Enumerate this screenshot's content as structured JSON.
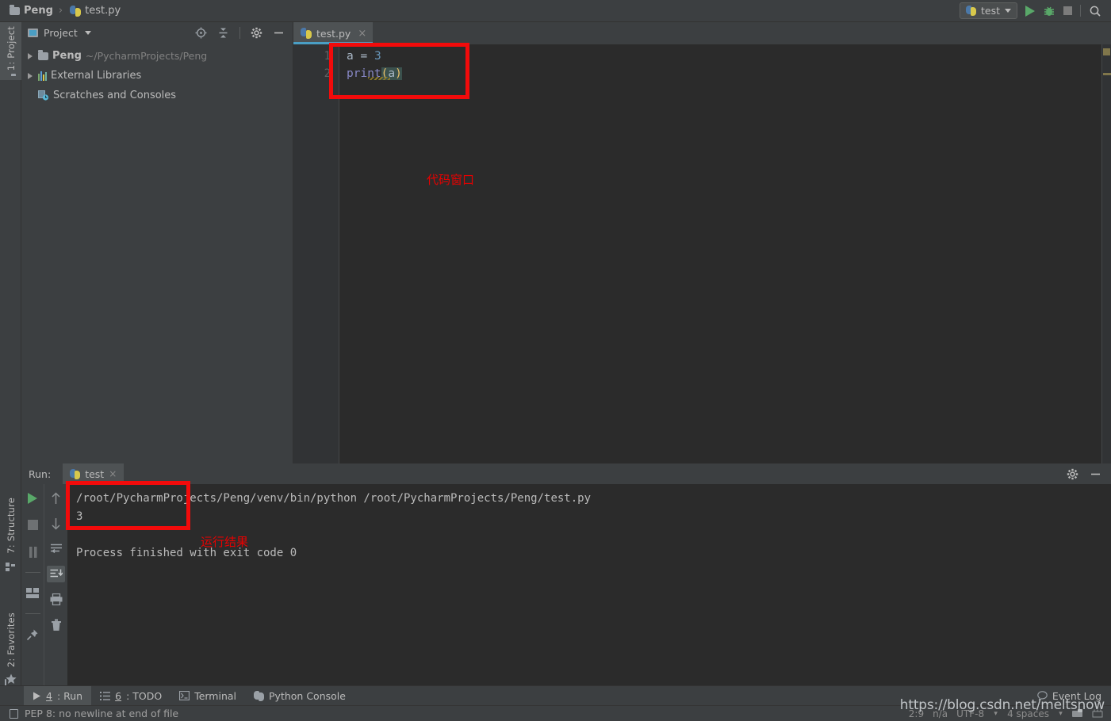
{
  "app": {
    "theme_bg": "#3c3f41",
    "editor_bg": "#2b2b2b",
    "accent": "#4a9ec4",
    "annotation_color": "#f20b0b"
  },
  "topbar": {
    "breadcrumb_project": "Peng",
    "breadcrumb_sep": "›",
    "breadcrumb_file": "test.py",
    "run_config_name": "test",
    "icons": {
      "run": "run-icon",
      "debug": "debug-icon",
      "stop": "stop-icon",
      "search": "search-icon"
    }
  },
  "left_strip": {
    "tabs": [
      {
        "label": "1: Project",
        "icon": "project-folder-icon",
        "active": true
      },
      {
        "label": "7: Structure",
        "icon": "structure-icon",
        "active": false
      },
      {
        "label": "2: Favorites",
        "icon": "star-icon",
        "active": false
      }
    ]
  },
  "project_panel": {
    "title": "Project",
    "tools": [
      "locate-icon",
      "collapse-all-icon",
      "settings-gear-icon",
      "hide-icon"
    ],
    "tree": [
      {
        "name": "Peng",
        "path": "~/PycharmProjects/Peng",
        "icon": "folder-icon",
        "expandable": true
      },
      {
        "name": "External Libraries",
        "path": "",
        "icon": "libraries-icon",
        "expandable": true
      },
      {
        "name": "Scratches and Consoles",
        "path": "",
        "icon": "scratches-icon",
        "expandable": false
      }
    ]
  },
  "editor": {
    "tab_label": "test.py",
    "tab_close": "×",
    "line_numbers": [
      "1",
      "2"
    ],
    "code": {
      "line1": {
        "var": "a",
        "op": "=",
        "value": "3"
      },
      "line2": {
        "fn": "print",
        "open": "(",
        "arg": "a",
        "close": ")"
      }
    },
    "annotation": "代码窗口"
  },
  "run_panel": {
    "label": "Run:",
    "tab_label": "test",
    "tab_close": "×",
    "header_tools": [
      "settings-gear-icon",
      "hide-icon"
    ],
    "left_toolbar": [
      "rerun-icon",
      "stop-icon",
      "pause-icon",
      "layout-icon",
      "pin-icon"
    ],
    "right_toolbar": [
      "up-arrow-icon",
      "down-arrow-icon",
      "soft-wrap-icon",
      "scroll-to-end-icon",
      "print-icon",
      "trash-icon"
    ],
    "console": {
      "command": "/root/PycharmProjects/Peng/venv/bin/python /root/PycharmProjects/Peng/test.py",
      "output": "3",
      "blank": "",
      "exit": "Process finished with exit code 0"
    },
    "annotation": "运行结果"
  },
  "bottom_bar": {
    "buttons": [
      {
        "num": "4",
        "label": ": Run",
        "icon": "run-triangle-icon",
        "active": true
      },
      {
        "num": "6",
        "label": ": TODO",
        "icon": "todo-list-icon",
        "active": false
      },
      {
        "num": "",
        "label": "Terminal",
        "icon": "terminal-icon",
        "active": false
      },
      {
        "num": "",
        "label": "Python Console",
        "icon": "python-console-icon",
        "active": false
      }
    ],
    "event_log": "Event Log"
  },
  "status_bar": {
    "message": "PEP 8: no newline at end of file",
    "caret": "2:9",
    "line_sep": "n/a",
    "encoding": "UTF-8",
    "indent": "4 spaces",
    "watermark": "https://blog.csdn.net/meltsnow"
  }
}
